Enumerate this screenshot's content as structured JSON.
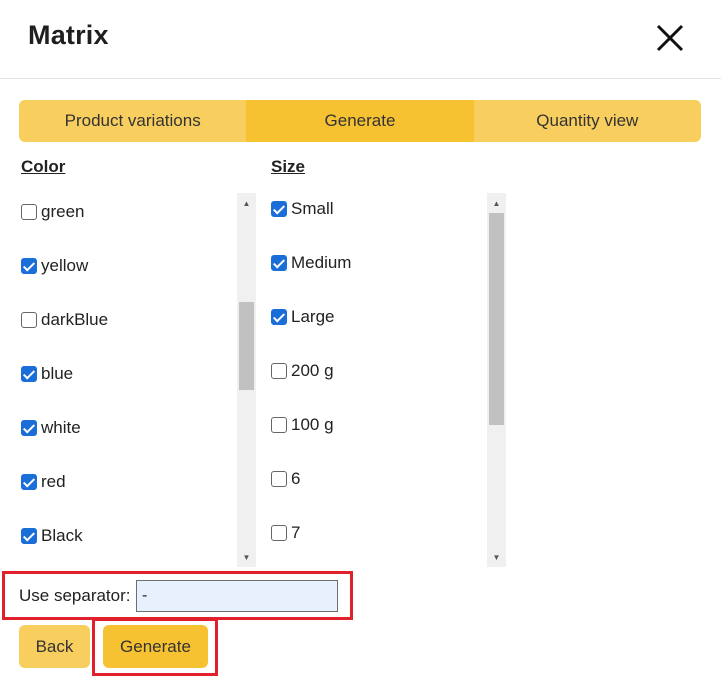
{
  "dialog": {
    "title": "Matrix",
    "close_icon": "close-icon"
  },
  "tabs": [
    {
      "label": "Product variations",
      "active": false
    },
    {
      "label": "Generate",
      "active": true
    },
    {
      "label": "Quantity view",
      "active": false
    }
  ],
  "color_column": {
    "header": "Color",
    "items": [
      {
        "label": "green",
        "checked": false
      },
      {
        "label": "yellow",
        "checked": true
      },
      {
        "label": "darkBlue",
        "checked": false
      },
      {
        "label": "blue",
        "checked": true
      },
      {
        "label": "white",
        "checked": true
      },
      {
        "label": "red",
        "checked": true
      },
      {
        "label": "Black",
        "checked": true
      }
    ]
  },
  "size_column": {
    "header": "Size",
    "items": [
      {
        "label": "Small",
        "checked": true
      },
      {
        "label": "Medium",
        "checked": true
      },
      {
        "label": "Large",
        "checked": true
      },
      {
        "label": "200 g",
        "checked": false
      },
      {
        "label": "100 g",
        "checked": false
      },
      {
        "label": "6",
        "checked": false
      },
      {
        "label": "7",
        "checked": false
      }
    ]
  },
  "separator": {
    "label": "Use separator:",
    "value": "-"
  },
  "buttons": {
    "back": "Back",
    "generate": "Generate"
  },
  "colors": {
    "tab_bg": "#f8ce5e",
    "tab_active_bg": "#f7c232",
    "highlight_border": "#e0202a",
    "checkbox_checked": "#1a6ed8"
  }
}
